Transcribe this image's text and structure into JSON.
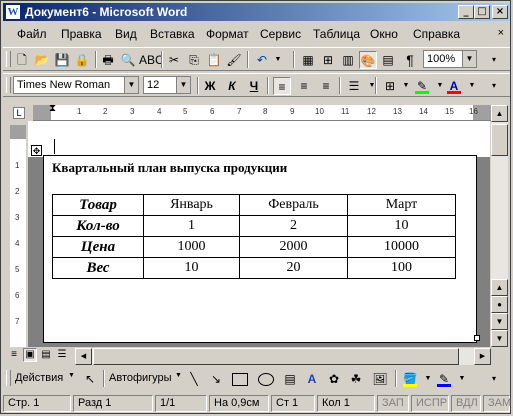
{
  "window": {
    "title": "Документ6 - Microsoft Word",
    "app_icon": "W",
    "controls": [
      "_",
      "□",
      "×"
    ]
  },
  "menu": {
    "items": [
      "Файл",
      "Правка",
      "Вид",
      "Вставка",
      "Формат",
      "Сервис",
      "Таблица",
      "Окно",
      "Справка"
    ],
    "close_doc": "×"
  },
  "standard_toolbar": {
    "zoom": "100%"
  },
  "formatting_toolbar": {
    "font": "Times New Roman",
    "size": "12",
    "bold": "Ж",
    "italic": "К",
    "underline": "Ч"
  },
  "ruler": {
    "numbers": [
      "1",
      "2",
      "3",
      "4",
      "5",
      "6",
      "7",
      "8",
      "9",
      "10",
      "11",
      "12",
      "13",
      "14",
      "15",
      "16"
    ]
  },
  "vruler": {
    "numbers": [
      "1",
      "2",
      "3",
      "4",
      "5",
      "6",
      "7"
    ]
  },
  "document": {
    "heading": "Квартальный план выпуска продукции",
    "table": {
      "header": [
        "Товар",
        "Январь",
        "Февраль",
        "Март"
      ],
      "rows": [
        [
          "Кол-во",
          "1",
          "2",
          "10"
        ],
        [
          "Цена",
          "1000",
          "2000",
          "10000"
        ],
        [
          "Вес",
          "10",
          "20",
          "100"
        ]
      ]
    }
  },
  "drawing_toolbar": {
    "actions": "Действия",
    "autoshapes": "Автофигуры"
  },
  "status": {
    "page": "Стр. 1",
    "section": "Разд 1",
    "pages": "1/1",
    "at": "На 0,9см",
    "line": "Ст 1",
    "col": "Кол 1",
    "rec": "ЗАП",
    "trk": "ИСПР",
    "ext": "ВДЛ",
    "ovr": "ЗАМ"
  },
  "colors": {
    "highlight": "#ffff00",
    "font_color": "#ff0000",
    "line_color": "#0000ff",
    "fill_color": "#ffff00"
  }
}
